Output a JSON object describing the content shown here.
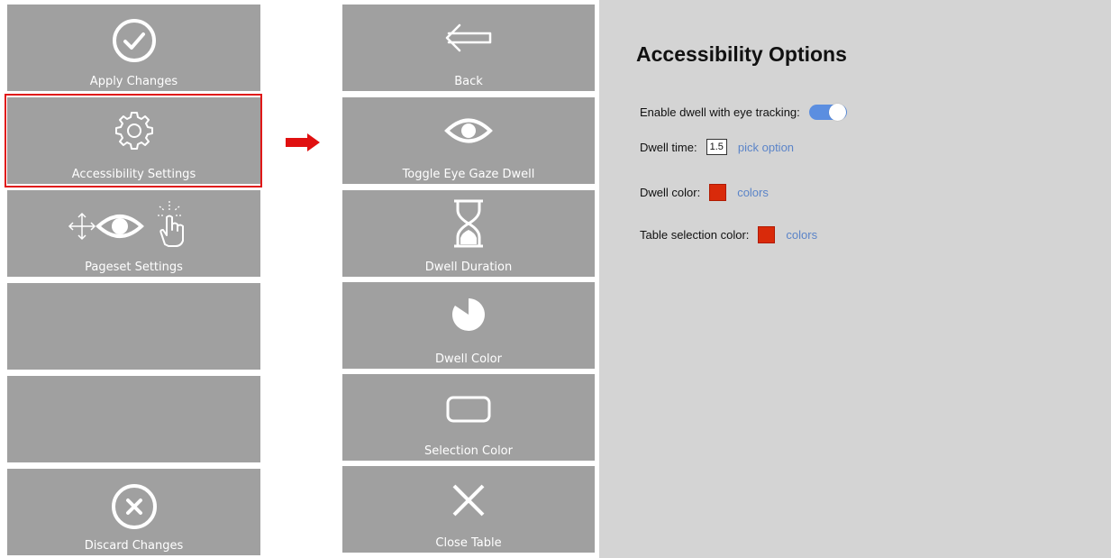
{
  "left_menu": {
    "tiles": [
      {
        "label": "Apply Changes",
        "icon": "check-circle-icon"
      },
      {
        "label": "Accessibility Settings",
        "icon": "gear-icon",
        "selected": true
      },
      {
        "label": "Pageset Settings",
        "icon": "move-eye-tap-icon"
      },
      {
        "label": ""
      },
      {
        "label": ""
      },
      {
        "label": "Discard Changes",
        "icon": "x-circle-icon"
      }
    ]
  },
  "transition_arrow": {
    "icon": "right-arrow-icon",
    "color": "#e01010"
  },
  "mid_menu": {
    "tiles": [
      {
        "label": "Back",
        "icon": "back-arrow-icon"
      },
      {
        "label": "Toggle Eye Gaze Dwell",
        "icon": "eye-icon"
      },
      {
        "label": "Dwell Duration",
        "icon": "hourglass-icon"
      },
      {
        "label": "Dwell Color",
        "icon": "pie-icon"
      },
      {
        "label": "Selection Color",
        "icon": "rounded-rect-icon"
      },
      {
        "label": "Close Table",
        "icon": "x-icon"
      }
    ]
  },
  "options": {
    "title": "Accessibility Options",
    "dwell_toggle": {
      "label": "Enable dwell with eye tracking:",
      "on": true
    },
    "dwell_time": {
      "label": "Dwell time:",
      "value": "1.5",
      "link": "pick option"
    },
    "dwell_color": {
      "label": "Dwell color:",
      "swatch": "#d92a0a",
      "link": "colors"
    },
    "table_color": {
      "label": "Table selection color:",
      "swatch": "#d92a0a",
      "link": "colors"
    }
  },
  "colors": {
    "tile_bg": "#a0a0a0",
    "panel_bg": "#d4d4d4",
    "toggle_on": "#5b8ee0",
    "link": "#5b84c8",
    "selection_border": "#e01818"
  }
}
